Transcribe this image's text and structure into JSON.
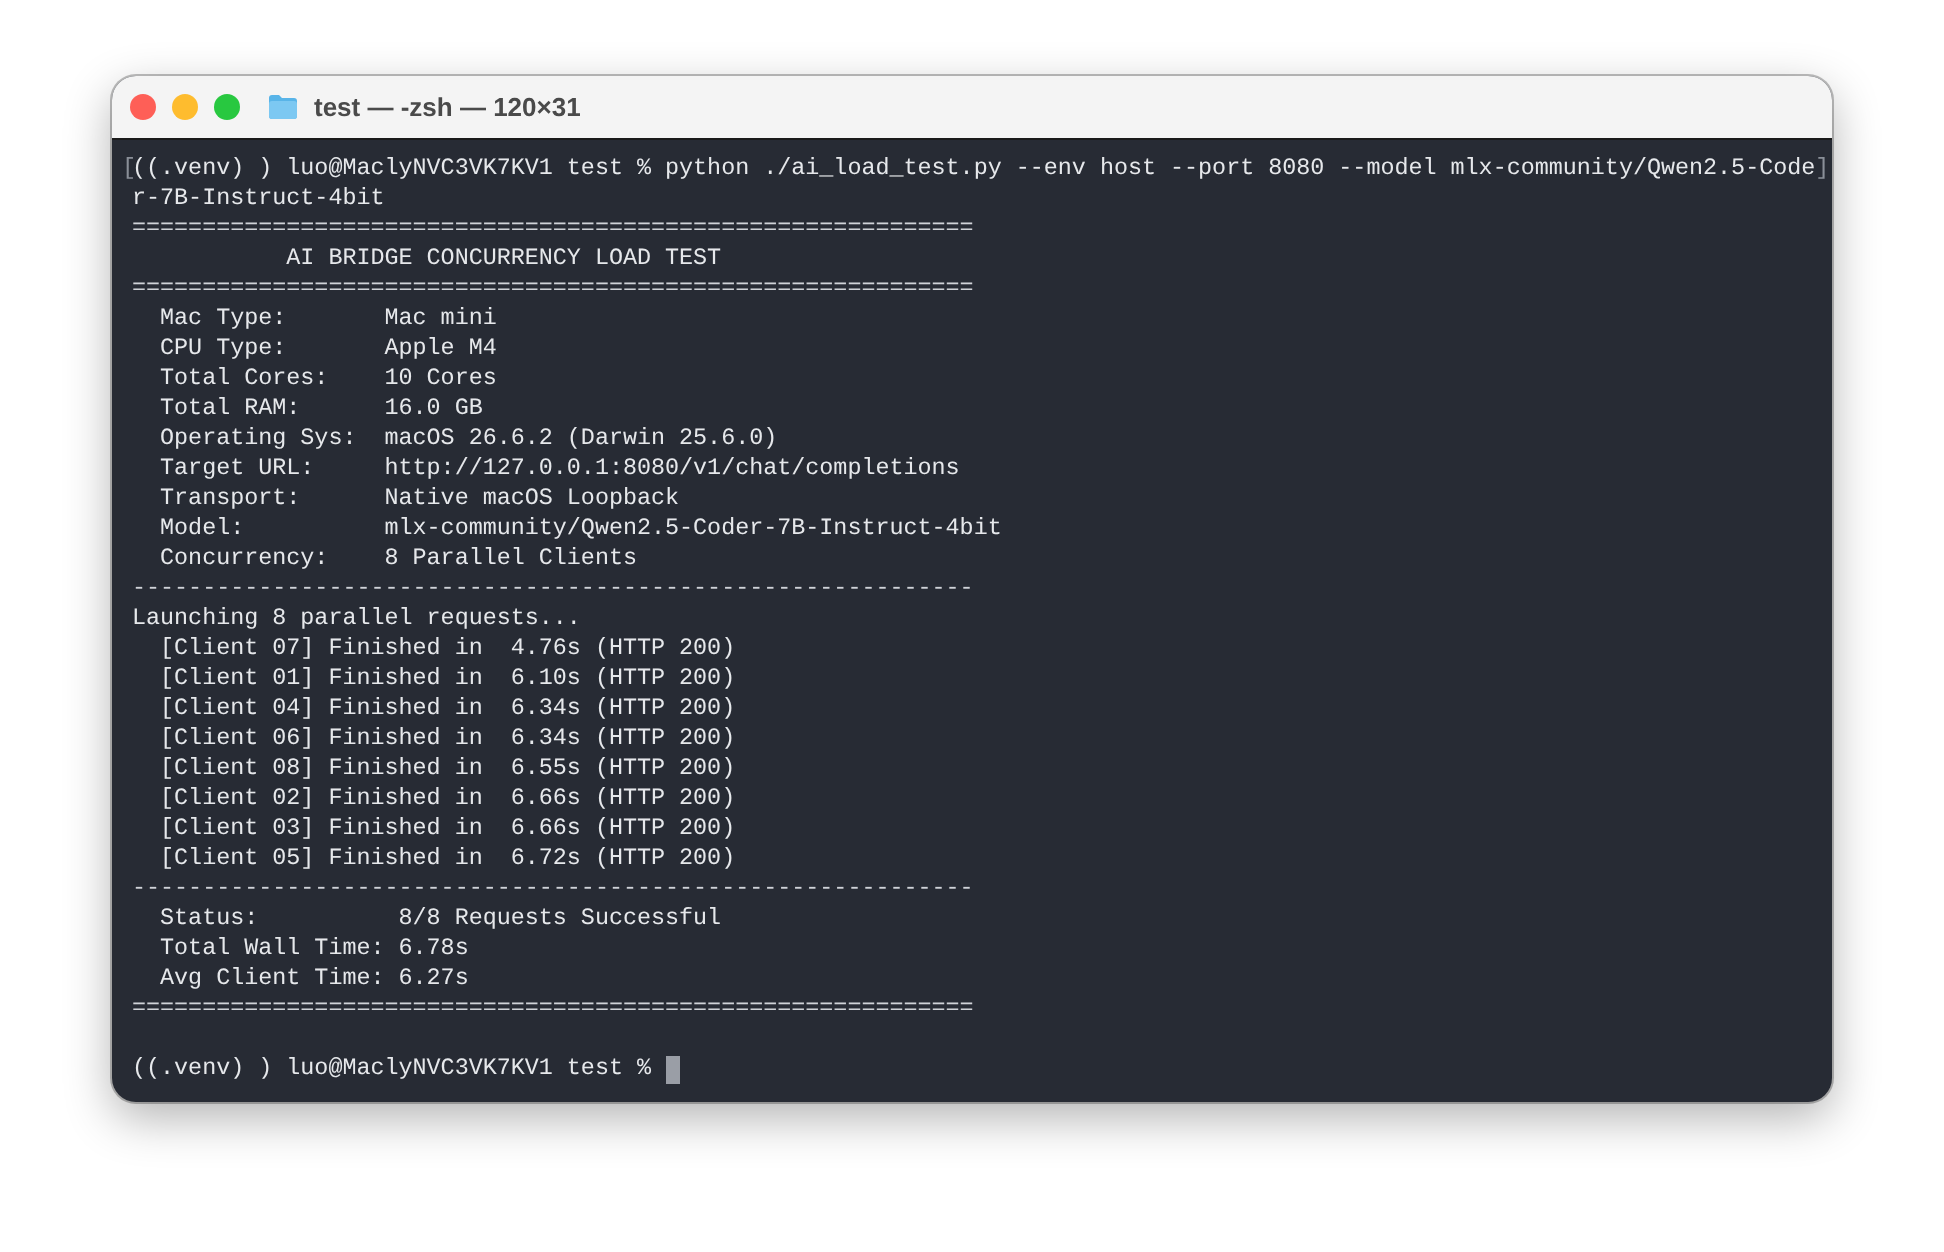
{
  "window": {
    "title": "test — -zsh — 120×31"
  },
  "terminal": {
    "lines": [
      {
        "kind": "command",
        "open_mark": "[",
        "text": "((.venv) ) luo@MaclyNVC3VK7KV1 test % python ./ai_load_test.py --env host --port 8080 --model mlx-community/Qwen2.5-Code",
        "close_mark": "]"
      },
      {
        "kind": "text",
        "text": "r-7B-Instruct-4bit"
      },
      {
        "kind": "rule",
        "text": "============================================================"
      },
      {
        "kind": "text",
        "text": "           AI BRIDGE CONCURRENCY LOAD TEST"
      },
      {
        "kind": "rule",
        "text": "============================================================"
      },
      {
        "kind": "text",
        "text": "  Mac Type:       Mac mini"
      },
      {
        "kind": "text",
        "text": "  CPU Type:       Apple M4"
      },
      {
        "kind": "text",
        "text": "  Total Cores:    10 Cores"
      },
      {
        "kind": "text",
        "text": "  Total RAM:      16.0 GB"
      },
      {
        "kind": "text",
        "text": "  Operating Sys:  macOS 26.6.2 (Darwin 25.6.0)"
      },
      {
        "kind": "text",
        "text": "  Target URL:     http://127.0.0.1:8080/v1/chat/completions"
      },
      {
        "kind": "text",
        "text": "  Transport:      Native macOS Loopback"
      },
      {
        "kind": "text",
        "text": "  Model:          mlx-community/Qwen2.5-Coder-7B-Instruct-4bit"
      },
      {
        "kind": "text",
        "text": "  Concurrency:    8 Parallel Clients"
      },
      {
        "kind": "rule",
        "text": "------------------------------------------------------------"
      },
      {
        "kind": "text",
        "text": "Launching 8 parallel requests..."
      },
      {
        "kind": "text",
        "text": "  [Client 07] Finished in  4.76s (HTTP 200)"
      },
      {
        "kind": "text",
        "text": "  [Client 01] Finished in  6.10s (HTTP 200)"
      },
      {
        "kind": "text",
        "text": "  [Client 04] Finished in  6.34s (HTTP 200)"
      },
      {
        "kind": "text",
        "text": "  [Client 06] Finished in  6.34s (HTTP 200)"
      },
      {
        "kind": "text",
        "text": "  [Client 08] Finished in  6.55s (HTTP 200)"
      },
      {
        "kind": "text",
        "text": "  [Client 02] Finished in  6.66s (HTTP 200)"
      },
      {
        "kind": "text",
        "text": "  [Client 03] Finished in  6.66s (HTTP 200)"
      },
      {
        "kind": "text",
        "text": "  [Client 05] Finished in  6.72s (HTTP 200)"
      },
      {
        "kind": "rule",
        "text": "------------------------------------------------------------"
      },
      {
        "kind": "text",
        "text": "  Status:          8/8 Requests Successful"
      },
      {
        "kind": "text",
        "text": "  Total Wall Time: 6.78s"
      },
      {
        "kind": "text",
        "text": "  Avg Client Time: 6.27s"
      },
      {
        "kind": "rule",
        "text": "============================================================"
      },
      {
        "kind": "blank"
      },
      {
        "kind": "prompt",
        "text": "((.venv) ) luo@MaclyNVC3VK7KV1 test %"
      }
    ]
  }
}
